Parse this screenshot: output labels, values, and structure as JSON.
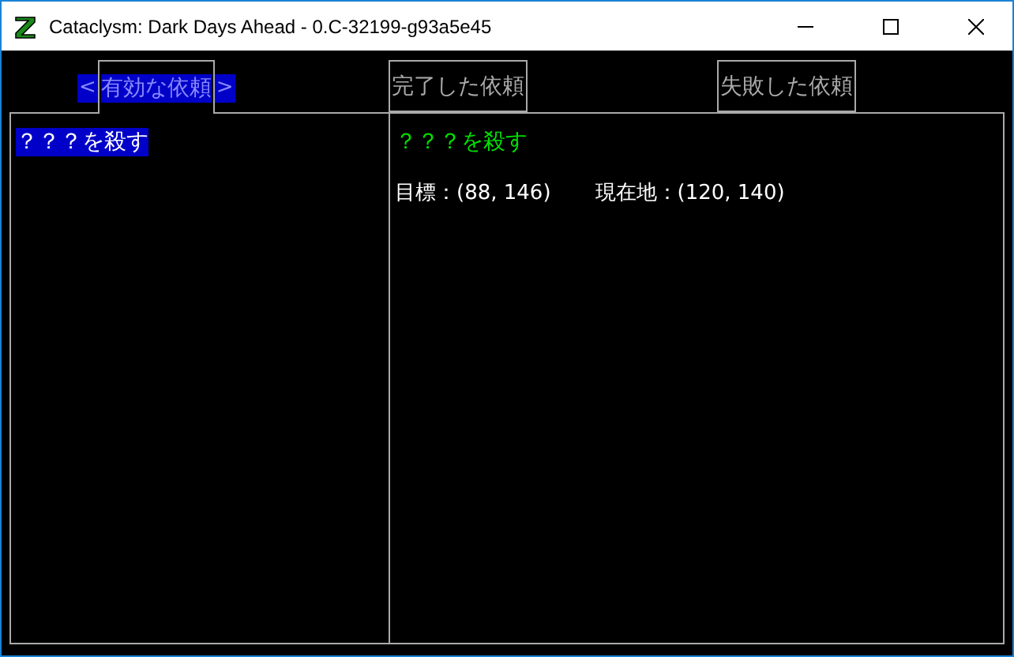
{
  "window": {
    "title": "Cataclysm: Dark Days Ahead - 0.C-32199-g93a5e45"
  },
  "tabs": [
    {
      "label": "有効な依頼",
      "selected": true
    },
    {
      "label": "完了した依頼",
      "selected": false
    },
    {
      "label": "失敗した依頼",
      "selected": false
    }
  ],
  "tab_arrows": {
    "left": "<",
    "right": ">"
  },
  "missions": [
    {
      "name": "？？？を殺す",
      "selected": true
    }
  ],
  "detail": {
    "title": "？？？を殺す",
    "target": "目標：(88, 146)",
    "location": "現在地：(120, 140)"
  }
}
